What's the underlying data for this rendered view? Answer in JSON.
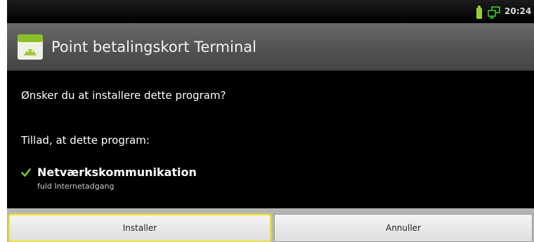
{
  "status_bar": {
    "time": "20:24",
    "icons": [
      "battery-icon",
      "network-icon"
    ],
    "battery_color": "#9acd32"
  },
  "dialog": {
    "title": "Point betalingskort Terminal",
    "question": "Ønsker du at installere dette program?",
    "allow_heading": "Tillad, at dette program:",
    "permissions": [
      {
        "title": "Netværkskommunikation",
        "description": "fuld Internetadgang",
        "icon": "check-icon"
      }
    ]
  },
  "buttons": {
    "install_label": "Installer",
    "cancel_label": "Annuller",
    "highlight_color": "#f0e033"
  }
}
